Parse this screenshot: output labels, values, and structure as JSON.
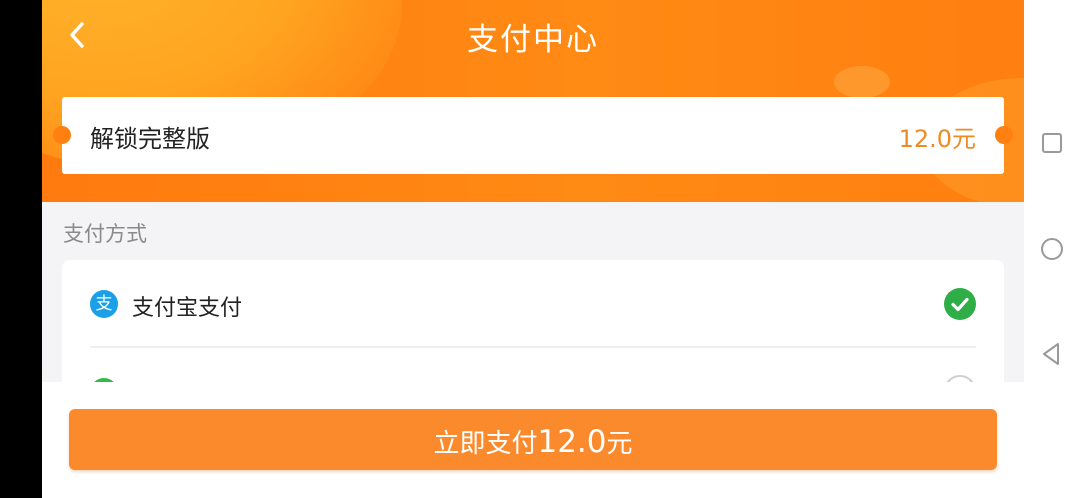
{
  "header": {
    "title": "支付中心",
    "back_icon": "chevron-left-icon"
  },
  "product": {
    "name": "解锁完整版",
    "price": "12.0元"
  },
  "payment": {
    "section_label": "支付方式",
    "methods": [
      {
        "label": "支付宝支付",
        "icon": "alipay-icon",
        "icon_glyph": "支",
        "selected": true
      },
      {
        "label": "",
        "icon": "wechat-pay-icon",
        "icon_glyph": "",
        "selected": false
      }
    ]
  },
  "footer": {
    "pay_label": "立即支付",
    "pay_amount": "12.0",
    "pay_unit": "元"
  },
  "system_nav": {
    "buttons": [
      "recent-apps-icon",
      "home-icon",
      "back-triangle-icon"
    ]
  },
  "colors": {
    "header_orange": "#ff7f10",
    "price_orange": "#f08a24",
    "button_orange": "#fb8a2c",
    "check_green": "#2fae47",
    "alipay_blue": "#1a9fe8"
  }
}
